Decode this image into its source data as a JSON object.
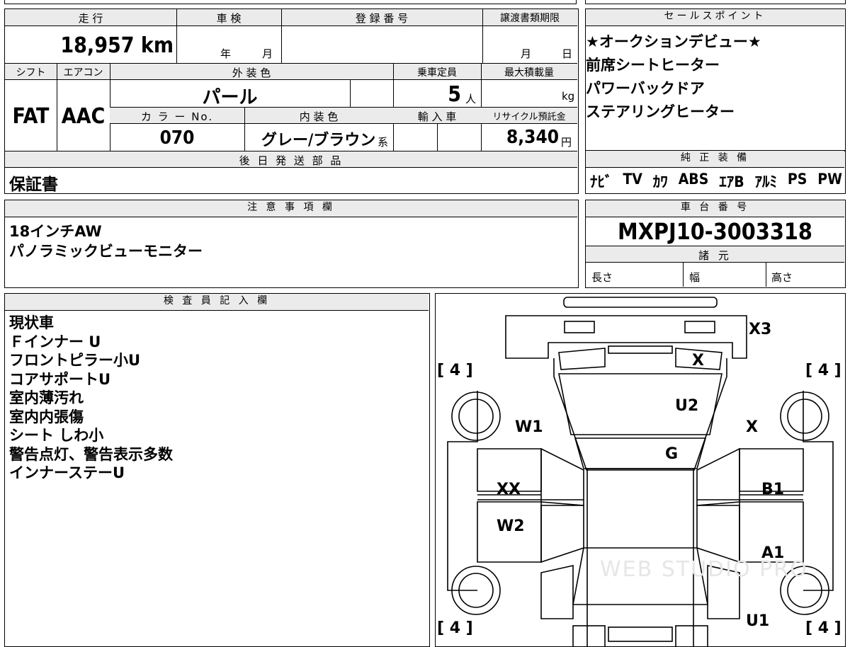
{
  "left_top": {
    "mileage_label": "走 行",
    "mileage_value": "18,957",
    "mileage_unit": "km",
    "shaken_label": "車 検",
    "shaken_year": "年",
    "shaken_month": "月",
    "reg_label": "登 録 番 号",
    "transfer_label": "譲渡書類期限",
    "transfer_month": "月",
    "transfer_day": "日",
    "shift_label": "シフト",
    "shift_value": "FAT",
    "ac_label": "エアコン",
    "ac_value": "AAC",
    "ext_color_label": "外 装 色",
    "ext_color_value": "パール",
    "capacity_label": "乗車定員",
    "capacity_value": "5",
    "capacity_unit": "人",
    "max_load_label": "最大積載量",
    "max_load_unit": "kg",
    "color_no_label": "カ ラ ー No.",
    "color_no_value": "070",
    "int_color_label": "内 装 色",
    "int_color_value": "グレー/ブラウン",
    "int_color_suffix": "系",
    "import_label": "輸 入 車",
    "recycle_label": "リサイクル預託金",
    "recycle_value": "8,340",
    "recycle_unit": "円",
    "later_parts_label": "後 日 発 送 部 品",
    "later_parts_value": "保証書"
  },
  "sales": {
    "header": "セールスポイント",
    "items": [
      "★オークションデビュー★",
      "前席シートヒーター",
      "パワーバックドア",
      "ステアリングヒーター"
    ]
  },
  "equipment": {
    "header": "純 正 装 備",
    "items": [
      "ﾅﾋﾞ",
      "TV",
      "ｶﾜ",
      "ABS",
      "ｴｱB",
      "ｱﾙﾐ",
      "PS",
      "PW"
    ]
  },
  "notes": {
    "header": "注 意 事 項 欄",
    "lines": [
      "18インチAW",
      "パノラミックビューモニター"
    ]
  },
  "chassis": {
    "header": "車 台 番 号",
    "value": "MXPJ10-3003318",
    "spec_header": "諸 元",
    "length_label": "長さ",
    "width_label": "幅",
    "height_label": "高さ"
  },
  "inspector": {
    "header": "検 査 員 記 入 欄",
    "lines": [
      "現状車",
      "Ｆインナー U",
      "フロントピラー小U",
      "コアサポートU",
      "室内薄汚れ",
      "室内内張傷",
      "シート しわ小",
      "警告点灯、警告表示多数",
      "インナーステーU"
    ]
  },
  "diagram": {
    "tire_fl": "[ 4 ]",
    "tire_fr": "[ 4 ]",
    "tire_rl": "[ 4 ]",
    "tire_rr": "[ 4 ]",
    "marks": {
      "x3": "X3",
      "x_front": "X",
      "u2": "U2",
      "w1": "W1",
      "x_right": "X",
      "g": "G",
      "xx": "XX",
      "b1": "B1",
      "w2": "W2",
      "a1": "A1",
      "u1": "U1"
    },
    "watermark": "WEB STUDIO PRO"
  }
}
